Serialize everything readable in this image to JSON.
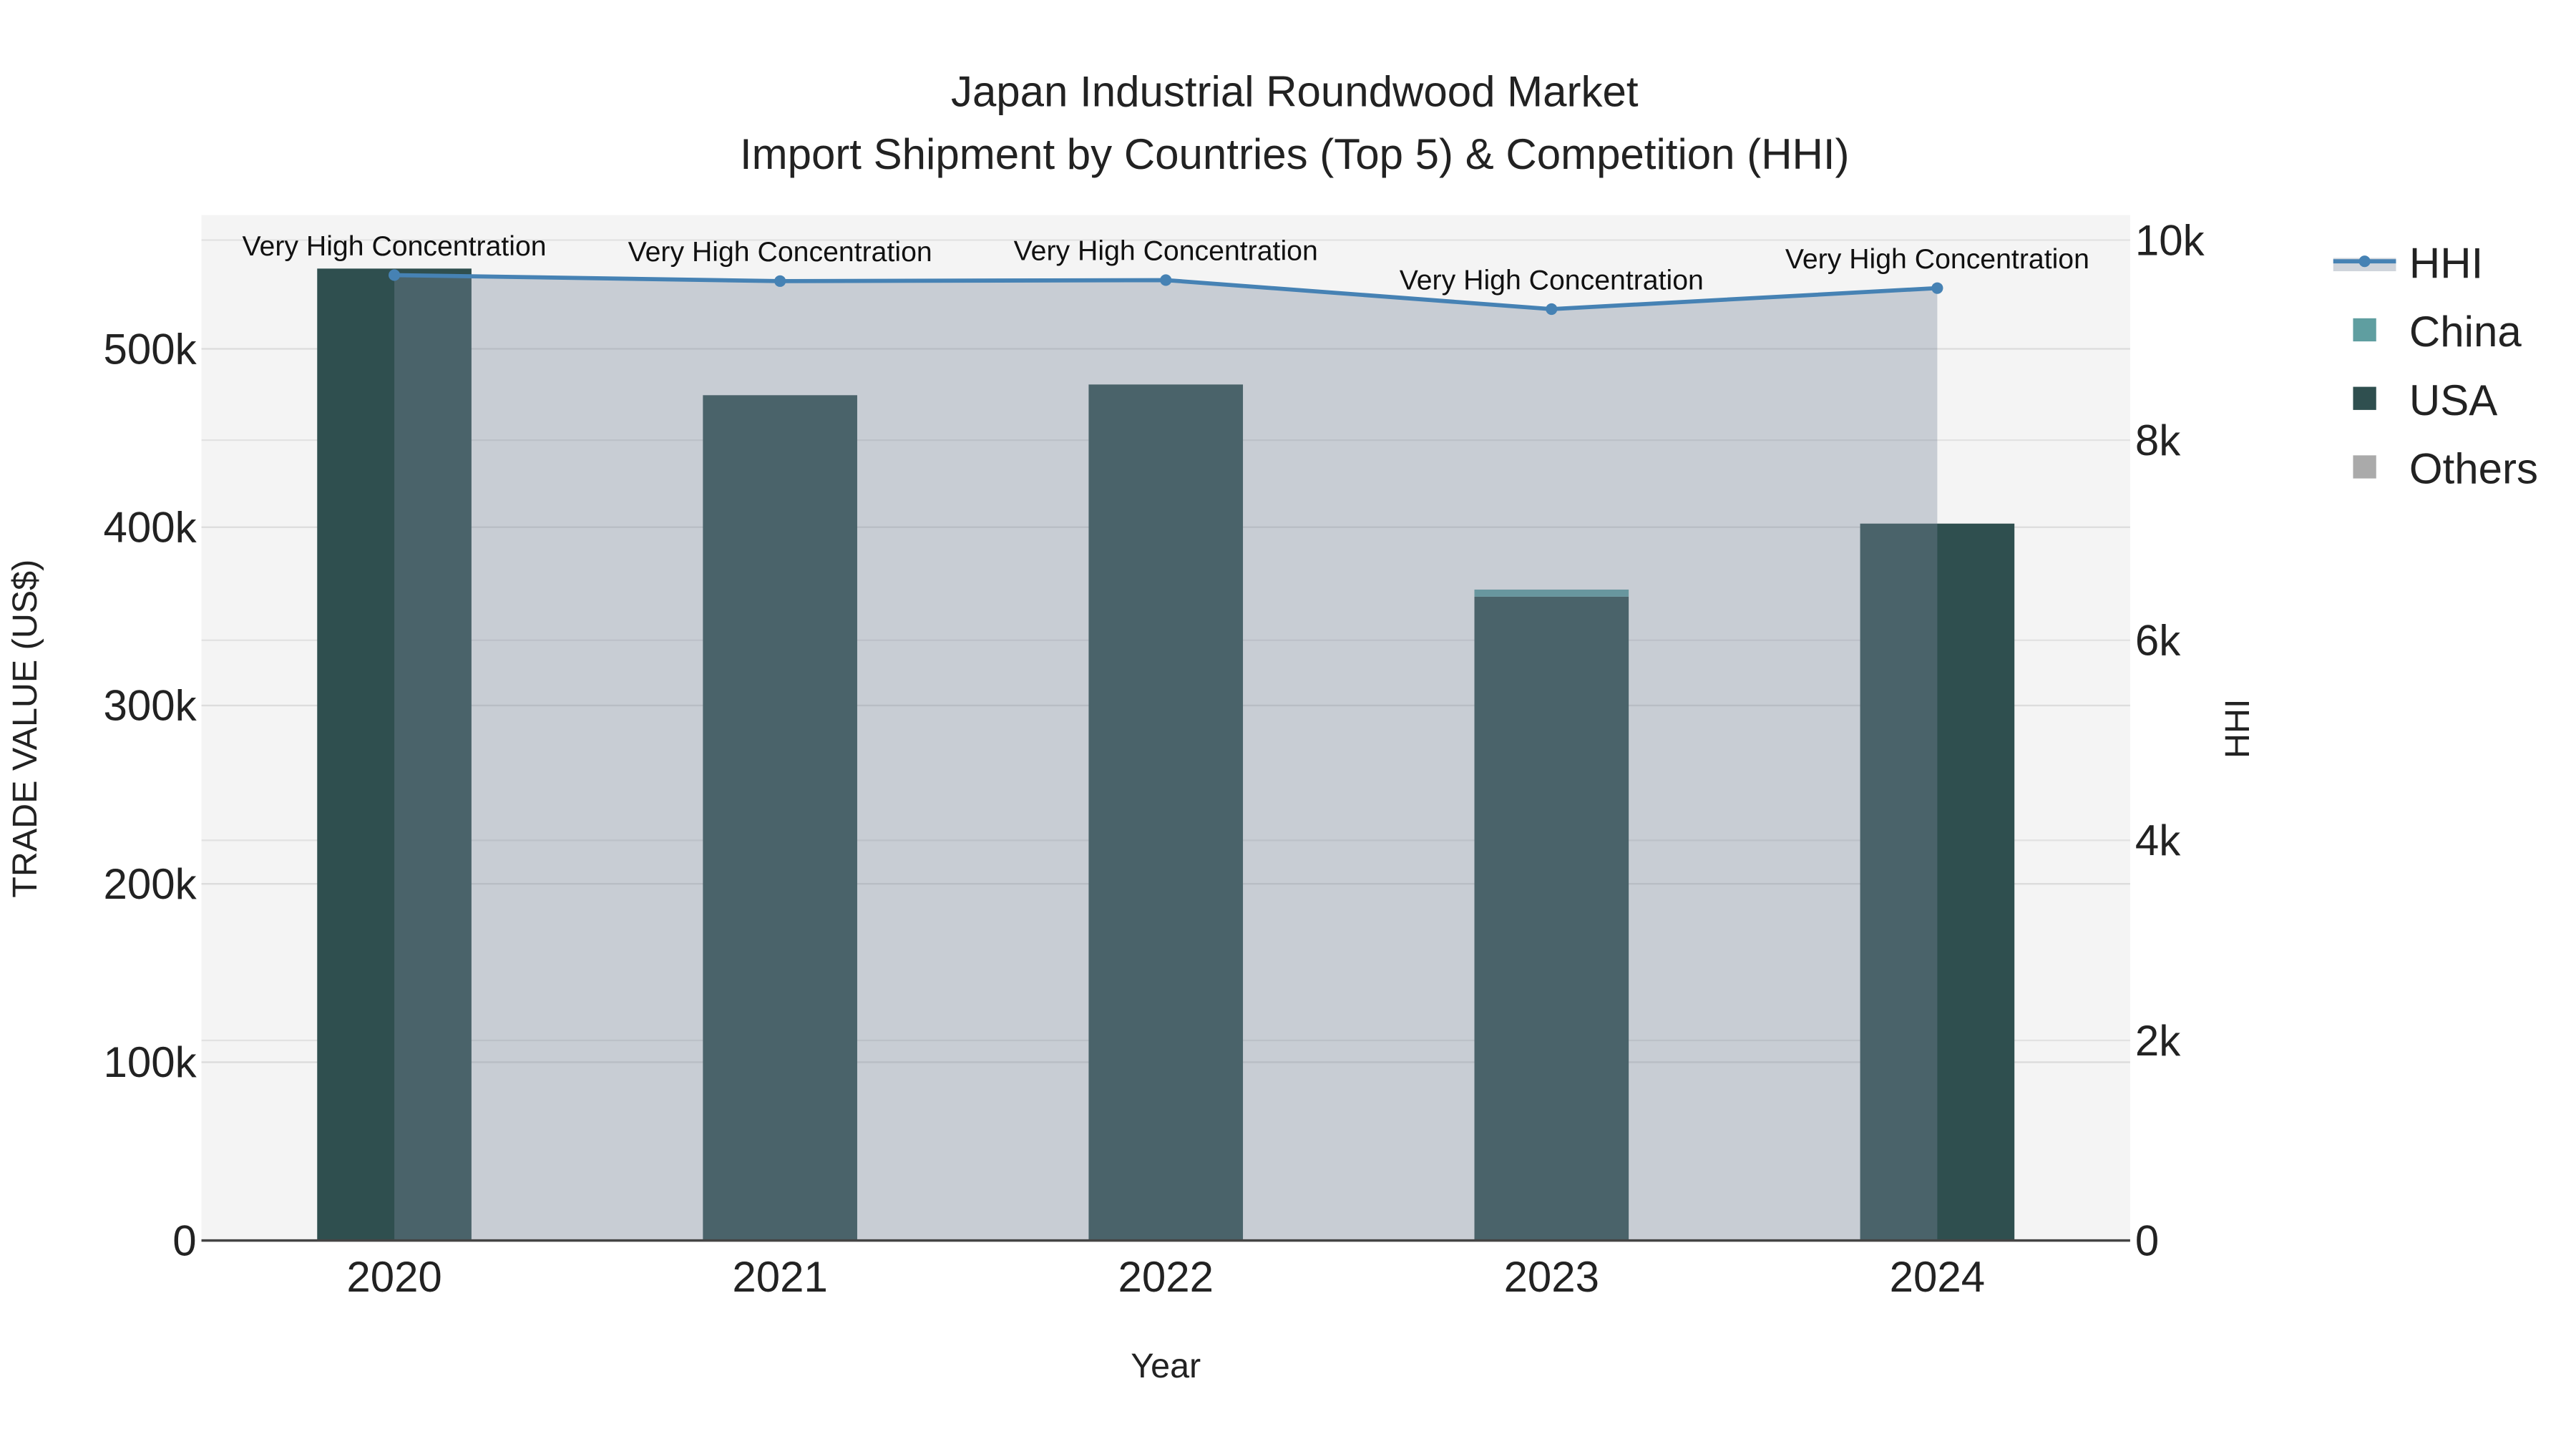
{
  "chart_data": {
    "type": "bar",
    "title": "Japan Industrial Roundwood Market",
    "subtitle": "Import Shipment by Countries (Top 5) & Competition (HHI)",
    "xlabel": "Year",
    "ylabel": "TRADE VALUE (US$)",
    "y2label": "HHI",
    "categories": [
      "2020",
      "2021",
      "2022",
      "2023",
      "2024"
    ],
    "ylim": [
      0,
      575000
    ],
    "y2lim": [
      0,
      10250
    ],
    "yticks": [
      0,
      100000,
      200000,
      300000,
      400000,
      500000
    ],
    "ytick_labels": [
      "0",
      "100k",
      "200k",
      "300k",
      "400k",
      "500k"
    ],
    "y2ticks": [
      0,
      2000,
      4000,
      6000,
      8000,
      10000
    ],
    "y2tick_labels": [
      "0",
      "2k",
      "4k",
      "6k",
      "8k",
      "10k"
    ],
    "grid": true,
    "legend_position": "top-right outside",
    "series": [
      {
        "name": "USA",
        "type": "bar",
        "color": "#2f4f4f",
        "values": [
          545000,
          474000,
          480000,
          361000,
          402000
        ]
      },
      {
        "name": "China",
        "type": "bar",
        "color": "#5f9ea0",
        "values": [
          0,
          0,
          0,
          4000,
          0
        ]
      },
      {
        "name": "Others",
        "type": "bar",
        "color": "#aaaaaa",
        "values": [
          0,
          0,
          0,
          0,
          0
        ]
      },
      {
        "name": "HHI",
        "type": "line",
        "axis": "right",
        "color": "#4682b4",
        "fill": "rgba(123,137,156,0.36)",
        "values": [
          9650,
          9590,
          9600,
          9310,
          9520
        ]
      }
    ],
    "annotations": [
      "Very High Concentration",
      "Very High Concentration",
      "Very High Concentration",
      "Very High Concentration",
      "Very High Concentration"
    ],
    "legend": [
      "HHI",
      "China",
      "USA",
      "Others"
    ]
  }
}
